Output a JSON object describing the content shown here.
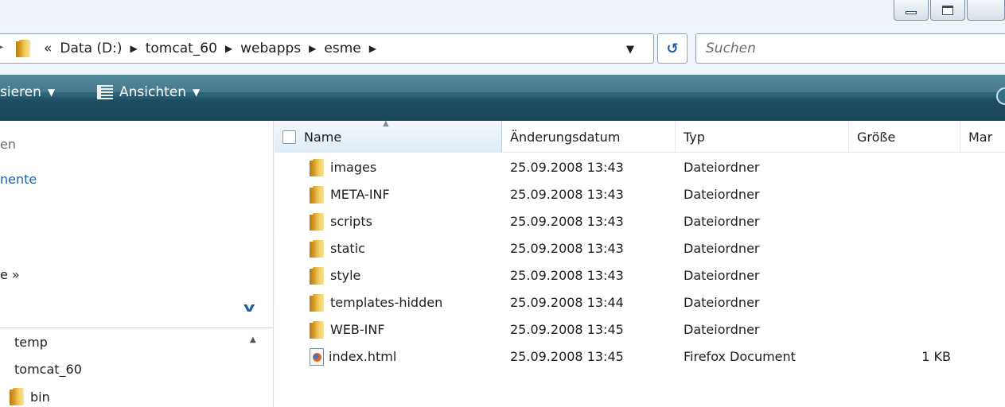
{
  "window": {
    "min_icon": "minimize-icon",
    "max_icon": "maximize-icon"
  },
  "address": {
    "overflow": "«",
    "crumbs": [
      "Data (D:)",
      "tomcat_60",
      "webapps",
      "esme"
    ],
    "separator": "▶",
    "dropdown": "▼",
    "refresh": "↺"
  },
  "search": {
    "placeholder": "Suchen"
  },
  "toolbar": {
    "organize": "sieren",
    "view": "Ansichten",
    "caret": "▼"
  },
  "nav": {
    "item1": "en",
    "item2": "nente",
    "more": "e »",
    "collapse": "v"
  },
  "tree": {
    "items": [
      "temp",
      "tomcat_60",
      "bin"
    ]
  },
  "columns": {
    "name": "Name",
    "date": "Änderungsdatum",
    "type": "Typ",
    "size": "Größe",
    "more": "Mar"
  },
  "files": [
    {
      "name": "images",
      "date": "25.09.2008 13:43",
      "type": "Dateiordner",
      "size": "",
      "icon": "folder-icon"
    },
    {
      "name": "META-INF",
      "date": "25.09.2008 13:43",
      "type": "Dateiordner",
      "size": "",
      "icon": "folder-icon"
    },
    {
      "name": "scripts",
      "date": "25.09.2008 13:43",
      "type": "Dateiordner",
      "size": "",
      "icon": "folder-icon"
    },
    {
      "name": "static",
      "date": "25.09.2008 13:43",
      "type": "Dateiordner",
      "size": "",
      "icon": "folder-icon"
    },
    {
      "name": "style",
      "date": "25.09.2008 13:43",
      "type": "Dateiordner",
      "size": "",
      "icon": "folder-icon"
    },
    {
      "name": "templates-hidden",
      "date": "25.09.2008 13:44",
      "type": "Dateiordner",
      "size": "",
      "icon": "folder-icon"
    },
    {
      "name": "WEB-INF",
      "date": "25.09.2008 13:45",
      "type": "Dateiordner",
      "size": "",
      "icon": "folder-icon"
    },
    {
      "name": "index.html",
      "date": "25.09.2008 13:45",
      "type": "Firefox Document",
      "size": "1 KB",
      "icon": "firefox-document-icon"
    }
  ]
}
